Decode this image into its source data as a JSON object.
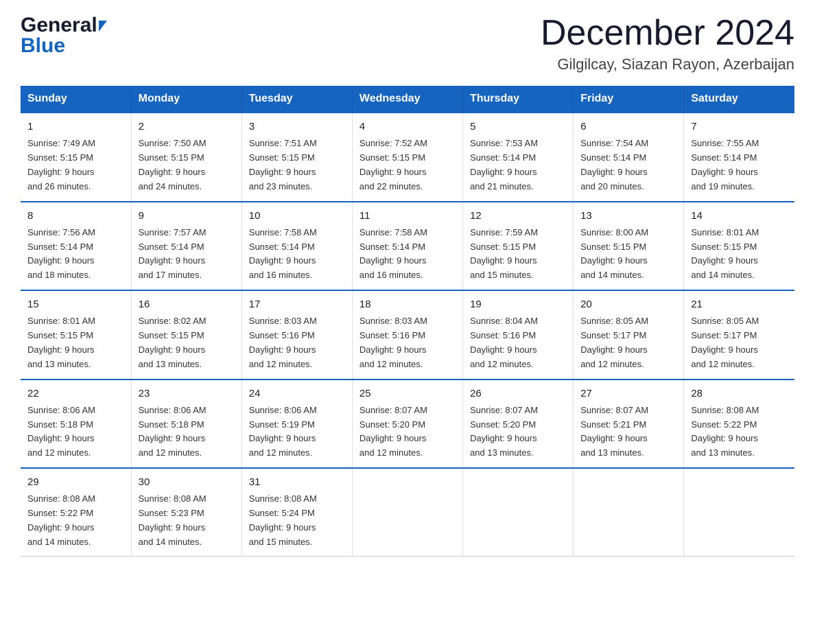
{
  "logo": {
    "general": "General",
    "blue": "Blue"
  },
  "title": "December 2024",
  "subtitle": "Gilgilcay, Siazan Rayon, Azerbaijan",
  "days": [
    "Sunday",
    "Monday",
    "Tuesday",
    "Wednesday",
    "Thursday",
    "Friday",
    "Saturday"
  ],
  "weeks": [
    [
      {
        "day": "1",
        "info": "Sunrise: 7:49 AM\nSunset: 5:15 PM\nDaylight: 9 hours\nand 26 minutes."
      },
      {
        "day": "2",
        "info": "Sunrise: 7:50 AM\nSunset: 5:15 PM\nDaylight: 9 hours\nand 24 minutes."
      },
      {
        "day": "3",
        "info": "Sunrise: 7:51 AM\nSunset: 5:15 PM\nDaylight: 9 hours\nand 23 minutes."
      },
      {
        "day": "4",
        "info": "Sunrise: 7:52 AM\nSunset: 5:15 PM\nDaylight: 9 hours\nand 22 minutes."
      },
      {
        "day": "5",
        "info": "Sunrise: 7:53 AM\nSunset: 5:14 PM\nDaylight: 9 hours\nand 21 minutes."
      },
      {
        "day": "6",
        "info": "Sunrise: 7:54 AM\nSunset: 5:14 PM\nDaylight: 9 hours\nand 20 minutes."
      },
      {
        "day": "7",
        "info": "Sunrise: 7:55 AM\nSunset: 5:14 PM\nDaylight: 9 hours\nand 19 minutes."
      }
    ],
    [
      {
        "day": "8",
        "info": "Sunrise: 7:56 AM\nSunset: 5:14 PM\nDaylight: 9 hours\nand 18 minutes."
      },
      {
        "day": "9",
        "info": "Sunrise: 7:57 AM\nSunset: 5:14 PM\nDaylight: 9 hours\nand 17 minutes."
      },
      {
        "day": "10",
        "info": "Sunrise: 7:58 AM\nSunset: 5:14 PM\nDaylight: 9 hours\nand 16 minutes."
      },
      {
        "day": "11",
        "info": "Sunrise: 7:58 AM\nSunset: 5:14 PM\nDaylight: 9 hours\nand 16 minutes."
      },
      {
        "day": "12",
        "info": "Sunrise: 7:59 AM\nSunset: 5:15 PM\nDaylight: 9 hours\nand 15 minutes."
      },
      {
        "day": "13",
        "info": "Sunrise: 8:00 AM\nSunset: 5:15 PM\nDaylight: 9 hours\nand 14 minutes."
      },
      {
        "day": "14",
        "info": "Sunrise: 8:01 AM\nSunset: 5:15 PM\nDaylight: 9 hours\nand 14 minutes."
      }
    ],
    [
      {
        "day": "15",
        "info": "Sunrise: 8:01 AM\nSunset: 5:15 PM\nDaylight: 9 hours\nand 13 minutes."
      },
      {
        "day": "16",
        "info": "Sunrise: 8:02 AM\nSunset: 5:15 PM\nDaylight: 9 hours\nand 13 minutes."
      },
      {
        "day": "17",
        "info": "Sunrise: 8:03 AM\nSunset: 5:16 PM\nDaylight: 9 hours\nand 12 minutes."
      },
      {
        "day": "18",
        "info": "Sunrise: 8:03 AM\nSunset: 5:16 PM\nDaylight: 9 hours\nand 12 minutes."
      },
      {
        "day": "19",
        "info": "Sunrise: 8:04 AM\nSunset: 5:16 PM\nDaylight: 9 hours\nand 12 minutes."
      },
      {
        "day": "20",
        "info": "Sunrise: 8:05 AM\nSunset: 5:17 PM\nDaylight: 9 hours\nand 12 minutes."
      },
      {
        "day": "21",
        "info": "Sunrise: 8:05 AM\nSunset: 5:17 PM\nDaylight: 9 hours\nand 12 minutes."
      }
    ],
    [
      {
        "day": "22",
        "info": "Sunrise: 8:06 AM\nSunset: 5:18 PM\nDaylight: 9 hours\nand 12 minutes."
      },
      {
        "day": "23",
        "info": "Sunrise: 8:06 AM\nSunset: 5:18 PM\nDaylight: 9 hours\nand 12 minutes."
      },
      {
        "day": "24",
        "info": "Sunrise: 8:06 AM\nSunset: 5:19 PM\nDaylight: 9 hours\nand 12 minutes."
      },
      {
        "day": "25",
        "info": "Sunrise: 8:07 AM\nSunset: 5:20 PM\nDaylight: 9 hours\nand 12 minutes."
      },
      {
        "day": "26",
        "info": "Sunrise: 8:07 AM\nSunset: 5:20 PM\nDaylight: 9 hours\nand 13 minutes."
      },
      {
        "day": "27",
        "info": "Sunrise: 8:07 AM\nSunset: 5:21 PM\nDaylight: 9 hours\nand 13 minutes."
      },
      {
        "day": "28",
        "info": "Sunrise: 8:08 AM\nSunset: 5:22 PM\nDaylight: 9 hours\nand 13 minutes."
      }
    ],
    [
      {
        "day": "29",
        "info": "Sunrise: 8:08 AM\nSunset: 5:22 PM\nDaylight: 9 hours\nand 14 minutes."
      },
      {
        "day": "30",
        "info": "Sunrise: 8:08 AM\nSunset: 5:23 PM\nDaylight: 9 hours\nand 14 minutes."
      },
      {
        "day": "31",
        "info": "Sunrise: 8:08 AM\nSunset: 5:24 PM\nDaylight: 9 hours\nand 15 minutes."
      },
      {
        "day": "",
        "info": ""
      },
      {
        "day": "",
        "info": ""
      },
      {
        "day": "",
        "info": ""
      },
      {
        "day": "",
        "info": ""
      }
    ]
  ]
}
